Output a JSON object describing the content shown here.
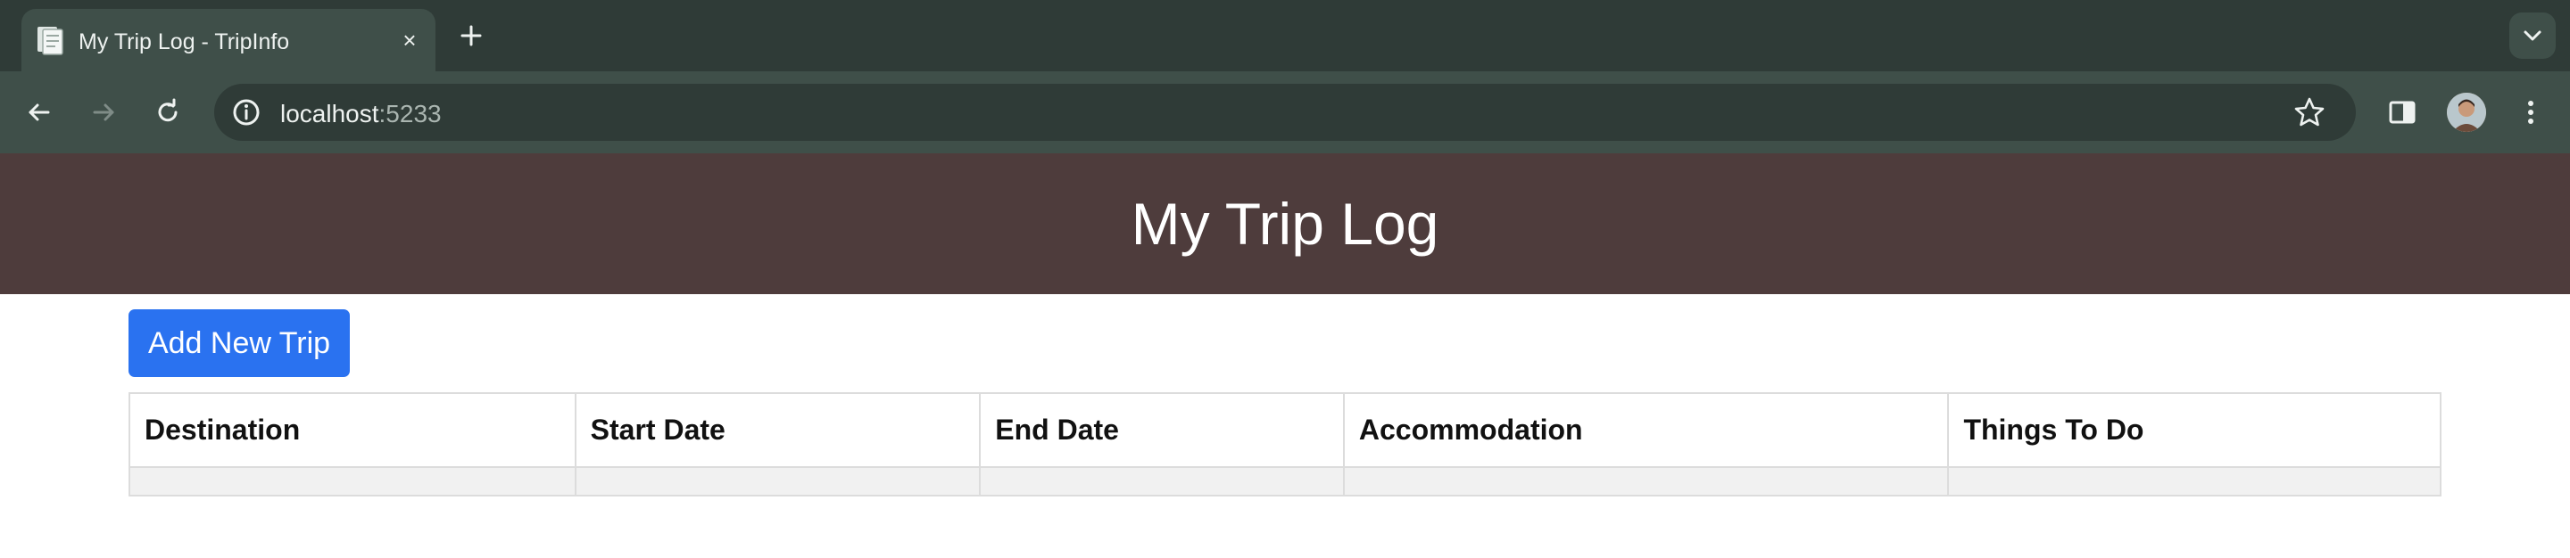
{
  "browser": {
    "tab": {
      "title": "My Trip Log - TripInfo",
      "favicon": "document-icon",
      "close_glyph": "×"
    },
    "address": {
      "host": "localhost",
      "port": ":5233"
    }
  },
  "header": {
    "title": "My Trip Log"
  },
  "actions": {
    "add_label": "Add New Trip"
  },
  "table": {
    "columns": [
      "Destination",
      "Start Date",
      "End Date",
      "Accommodation",
      "Things To Do"
    ],
    "rows": []
  },
  "colors": {
    "header_bg": "#4e3c3c",
    "button_bg": "#2a72f0",
    "chrome_dark": "#2f3b37",
    "chrome_light": "#3f4f49"
  }
}
